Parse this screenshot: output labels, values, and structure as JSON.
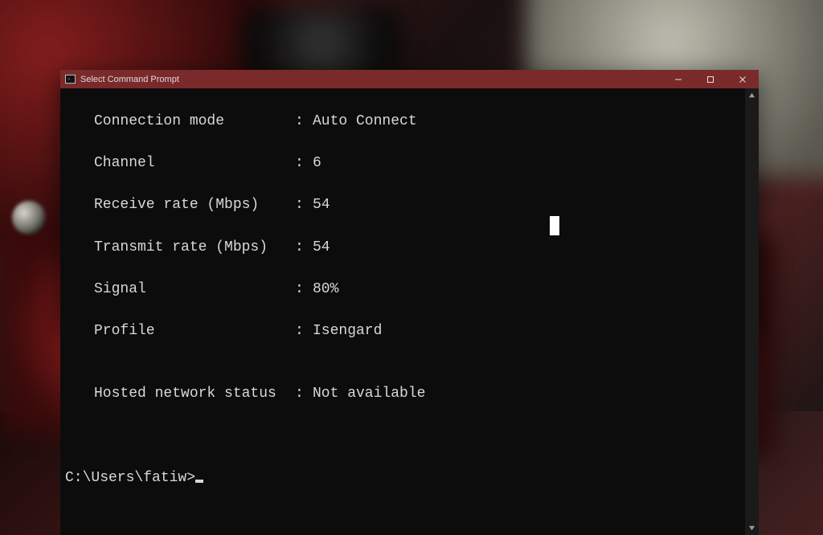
{
  "window": {
    "title": "Select Command Prompt"
  },
  "output": {
    "lines": [
      {
        "label": "Connection mode",
        "value": "Auto Connect"
      },
      {
        "label": "Channel",
        "value": "6"
      },
      {
        "label": "Receive rate (Mbps)",
        "value": "54"
      },
      {
        "label": "Transmit rate (Mbps)",
        "value": "54"
      },
      {
        "label": "Signal",
        "value": "80%"
      },
      {
        "label": "Profile",
        "value": "Isengard"
      }
    ],
    "blank": "",
    "hosted": {
      "label": "Hosted network status",
      "value": "Not available"
    }
  },
  "prompt": {
    "path": "C:\\Users\\fatiw>"
  },
  "colors": {
    "titlebar": "#7a2a2a",
    "terminal_bg": "#0c0c0c",
    "terminal_fg": "#d8d8d8"
  }
}
